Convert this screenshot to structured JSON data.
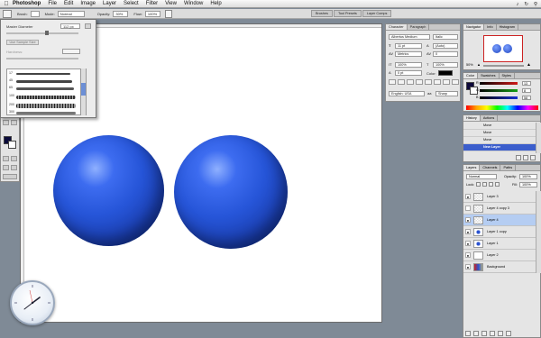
{
  "menubar": {
    "app_name": "Photoshop",
    "items": [
      "File",
      "Edit",
      "Image",
      "Layer",
      "Select",
      "Filter",
      "View",
      "Window",
      "Help"
    ]
  },
  "options_bar": {
    "brush_label": "Brush:",
    "mode_label": "Mode:",
    "mode_value": "Normal",
    "opacity_label": "Opacity:",
    "opacity_value": "30%",
    "flow_label": "Flow:",
    "flow_value": "100%",
    "dock_tabs": [
      "Brushes",
      "Tool Presets",
      "Layer Comps"
    ]
  },
  "brush_popup": {
    "master_diameter_label": "Master Diameter",
    "master_diameter_value": "112 px",
    "use_sample_size_label": "Use Sample Size",
    "hardness_label": "Hardness:",
    "brush_sizes": [
      "17",
      "45",
      "65",
      "100",
      "200",
      "300"
    ]
  },
  "character_palette": {
    "tabs": [
      "Character",
      "Paragraph"
    ],
    "font_family": "Albertus Medium",
    "font_style": "Italic",
    "font_size": "11 pt",
    "leading": "(Auto)",
    "kerning": "Metrics",
    "tracking": "0",
    "vertical_scale": "100%",
    "horizontal_scale": "100%",
    "baseline_shift": "0 pt",
    "color_label": "Color:",
    "language": "English: USA",
    "antialias": "Sharp"
  },
  "navigator": {
    "tabs": [
      "Navigator",
      "Info",
      "Histogram"
    ],
    "zoom_value": "50%"
  },
  "color_palette": {
    "tabs": [
      "Color",
      "Swatches",
      "Styles"
    ],
    "channels": [
      {
        "label": "R",
        "value": "13",
        "color": "#d01818"
      },
      {
        "label": "G",
        "value": "8",
        "color": "#18a018"
      },
      {
        "label": "B",
        "value": "58",
        "color": "#1830d0"
      }
    ]
  },
  "history_palette": {
    "tabs": [
      "History",
      "Actions"
    ],
    "items": [
      {
        "label": "Move",
        "selected": false
      },
      {
        "label": "Move",
        "selected": false
      },
      {
        "label": "Move",
        "selected": false
      },
      {
        "label": "New Layer",
        "selected": true
      }
    ]
  },
  "layers_palette": {
    "tabs": [
      "Layers",
      "Channels",
      "Paths"
    ],
    "blend_mode": "Normal",
    "opacity_label": "Opacity:",
    "opacity_value": "100%",
    "lock_label": "Lock:",
    "fill_label": "Fill:",
    "fill_value": "100%",
    "layers": [
      {
        "name": "Layer 3",
        "selected": false
      },
      {
        "name": "Layer 4 copy 3",
        "selected": false
      },
      {
        "name": "Layer 4",
        "selected": true
      },
      {
        "name": "Layer 1 copy",
        "selected": false
      },
      {
        "name": "Layer 1",
        "selected": false
      },
      {
        "name": "Layer 2",
        "selected": false
      },
      {
        "name": "Background",
        "selected": false
      }
    ]
  }
}
